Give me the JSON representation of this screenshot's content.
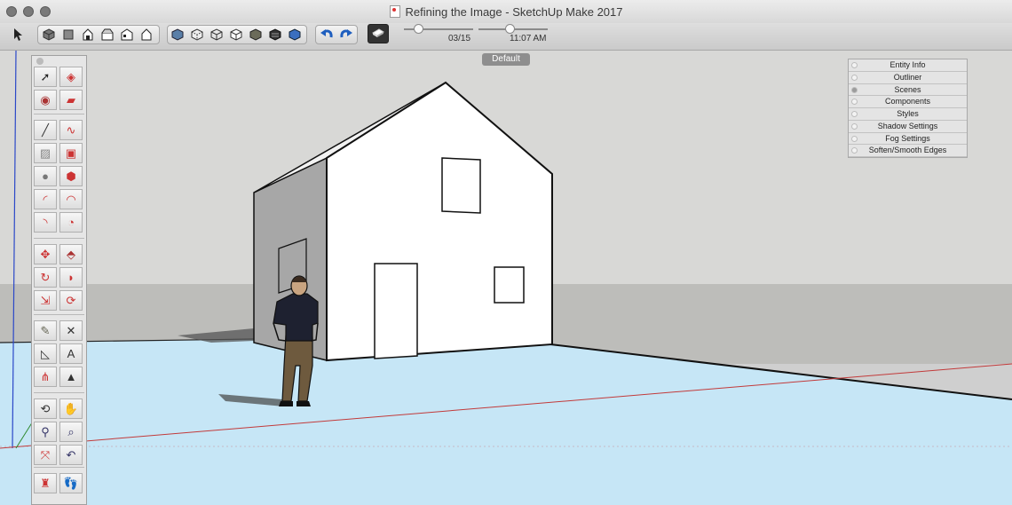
{
  "window": {
    "title": "Refining the Image - SketchUp Make 2017"
  },
  "toolbar": {
    "select_icon": "select-arrow-icon",
    "views": [
      "iso-view-icon",
      "top-view-icon",
      "front-view-icon",
      "right-view-icon",
      "back-view-icon",
      "left-view-icon"
    ],
    "styles": [
      "xray-icon",
      "back-edges-icon",
      "wireframe-icon",
      "hidden-line-icon",
      "shaded-icon",
      "shaded-textures-icon",
      "monochrome-icon"
    ],
    "undo_icon": "undo-icon",
    "redo_icon": "redo-icon",
    "shadows_icon": "shadows-icon",
    "date_slider": {
      "label": "03/15",
      "value": 0.2
    },
    "time_slider": {
      "label": "11:07 AM",
      "value": 0.45
    }
  },
  "scene_tab": {
    "label": "Default"
  },
  "tray": {
    "items": [
      {
        "label": "Entity Info",
        "active": false
      },
      {
        "label": "Outliner",
        "active": false
      },
      {
        "label": "Scenes",
        "active": true
      },
      {
        "label": "Components",
        "active": false
      },
      {
        "label": "Styles",
        "active": false
      },
      {
        "label": "Shadow Settings",
        "active": false
      },
      {
        "label": "Fog Settings",
        "active": false
      },
      {
        "label": "Soften/Smooth Edges",
        "active": false
      }
    ]
  },
  "palette": {
    "tools": [
      "select-icon",
      "make-component-icon",
      "paint-bucket-icon",
      "eraser-icon",
      "line-icon",
      "freehand-icon",
      "rectangle-icon",
      "rotated-rectangle-icon",
      "circle-icon",
      "polygon-icon",
      "arc-icon",
      "two-point-arc-icon",
      "three-point-arc-icon",
      "pie-icon",
      "move-icon",
      "push-pull-icon",
      "rotate-icon",
      "follow-me-icon",
      "scale-icon",
      "offset-icon",
      "tape-measure-icon",
      "dimension-icon",
      "protractor-icon",
      "text-icon",
      "axes-icon",
      "3d-text-icon",
      "orbit-icon",
      "pan-icon",
      "zoom-icon",
      "zoom-window-icon",
      "zoom-extents-icon",
      "previous-view-icon",
      "position-camera-icon",
      "walk-icon"
    ]
  },
  "colors": {
    "sky": "#d6d6d4",
    "ground": "#c7e6f5",
    "ground_far": "#bdbdba",
    "house_front": "#ffffff",
    "house_side": "#a9a9a9",
    "axis_red": "#c23a3a",
    "axis_green": "#2f8a2f",
    "axis_blue": "#2b48c8"
  }
}
